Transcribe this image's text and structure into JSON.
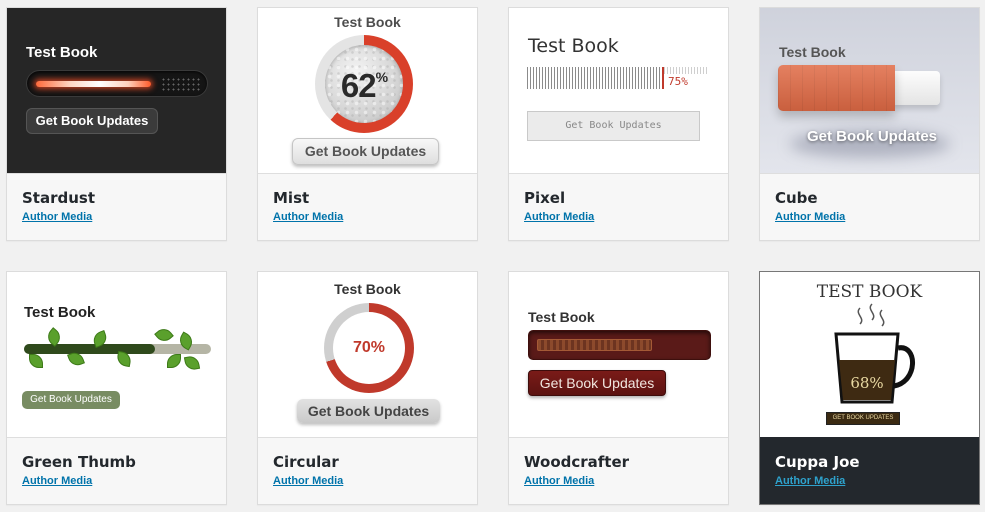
{
  "common": {
    "book_title": "Test Book",
    "button_label": "Get Book Updates"
  },
  "themes": [
    {
      "name": "Stardust",
      "author": "Author Media",
      "progress_fraction": 0.7
    },
    {
      "name": "Mist",
      "author": "Author Media",
      "percent": 62,
      "percent_sign": "%",
      "accent": "#d9402a"
    },
    {
      "name": "Pixel",
      "author": "Author Media",
      "percent_label": "75%",
      "percent": 75
    },
    {
      "name": "Cube",
      "author": "Author Media",
      "progress_fraction": 0.72
    },
    {
      "name": "Green Thumb",
      "author": "Author Media",
      "progress_fraction": 0.7
    },
    {
      "name": "Circular",
      "author": "Author Media",
      "percent_label": "70%",
      "percent": 70,
      "accent": "#c0392b"
    },
    {
      "name": "Woodcrafter",
      "author": "Author Media",
      "progress_fraction": 0.7
    },
    {
      "name": "Cuppa Joe",
      "author": "Author Media",
      "book_title": "TEST BOOK",
      "percent_label": "68%",
      "button_label": "GET BOOK UPDATES",
      "selected": true
    }
  ]
}
